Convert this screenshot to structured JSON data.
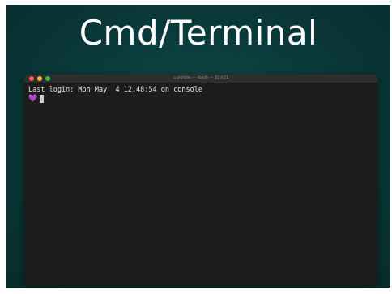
{
  "slide": {
    "title": "Cmd/Terminal"
  },
  "window": {
    "title": "purple — -bash — 81×21"
  },
  "terminal": {
    "last_login": "Last login: Mon May  4 12:48:54 on console",
    "prompt_symbol": "💜"
  },
  "icons": {
    "close": "red-close-icon",
    "minimize": "yellow-minimize-icon",
    "zoom": "green-zoom-icon",
    "home": "home-icon"
  },
  "colors": {
    "background": "#0b3b3c",
    "terminal_bg": "#1c1c1c",
    "prompt": "#b36bff"
  }
}
